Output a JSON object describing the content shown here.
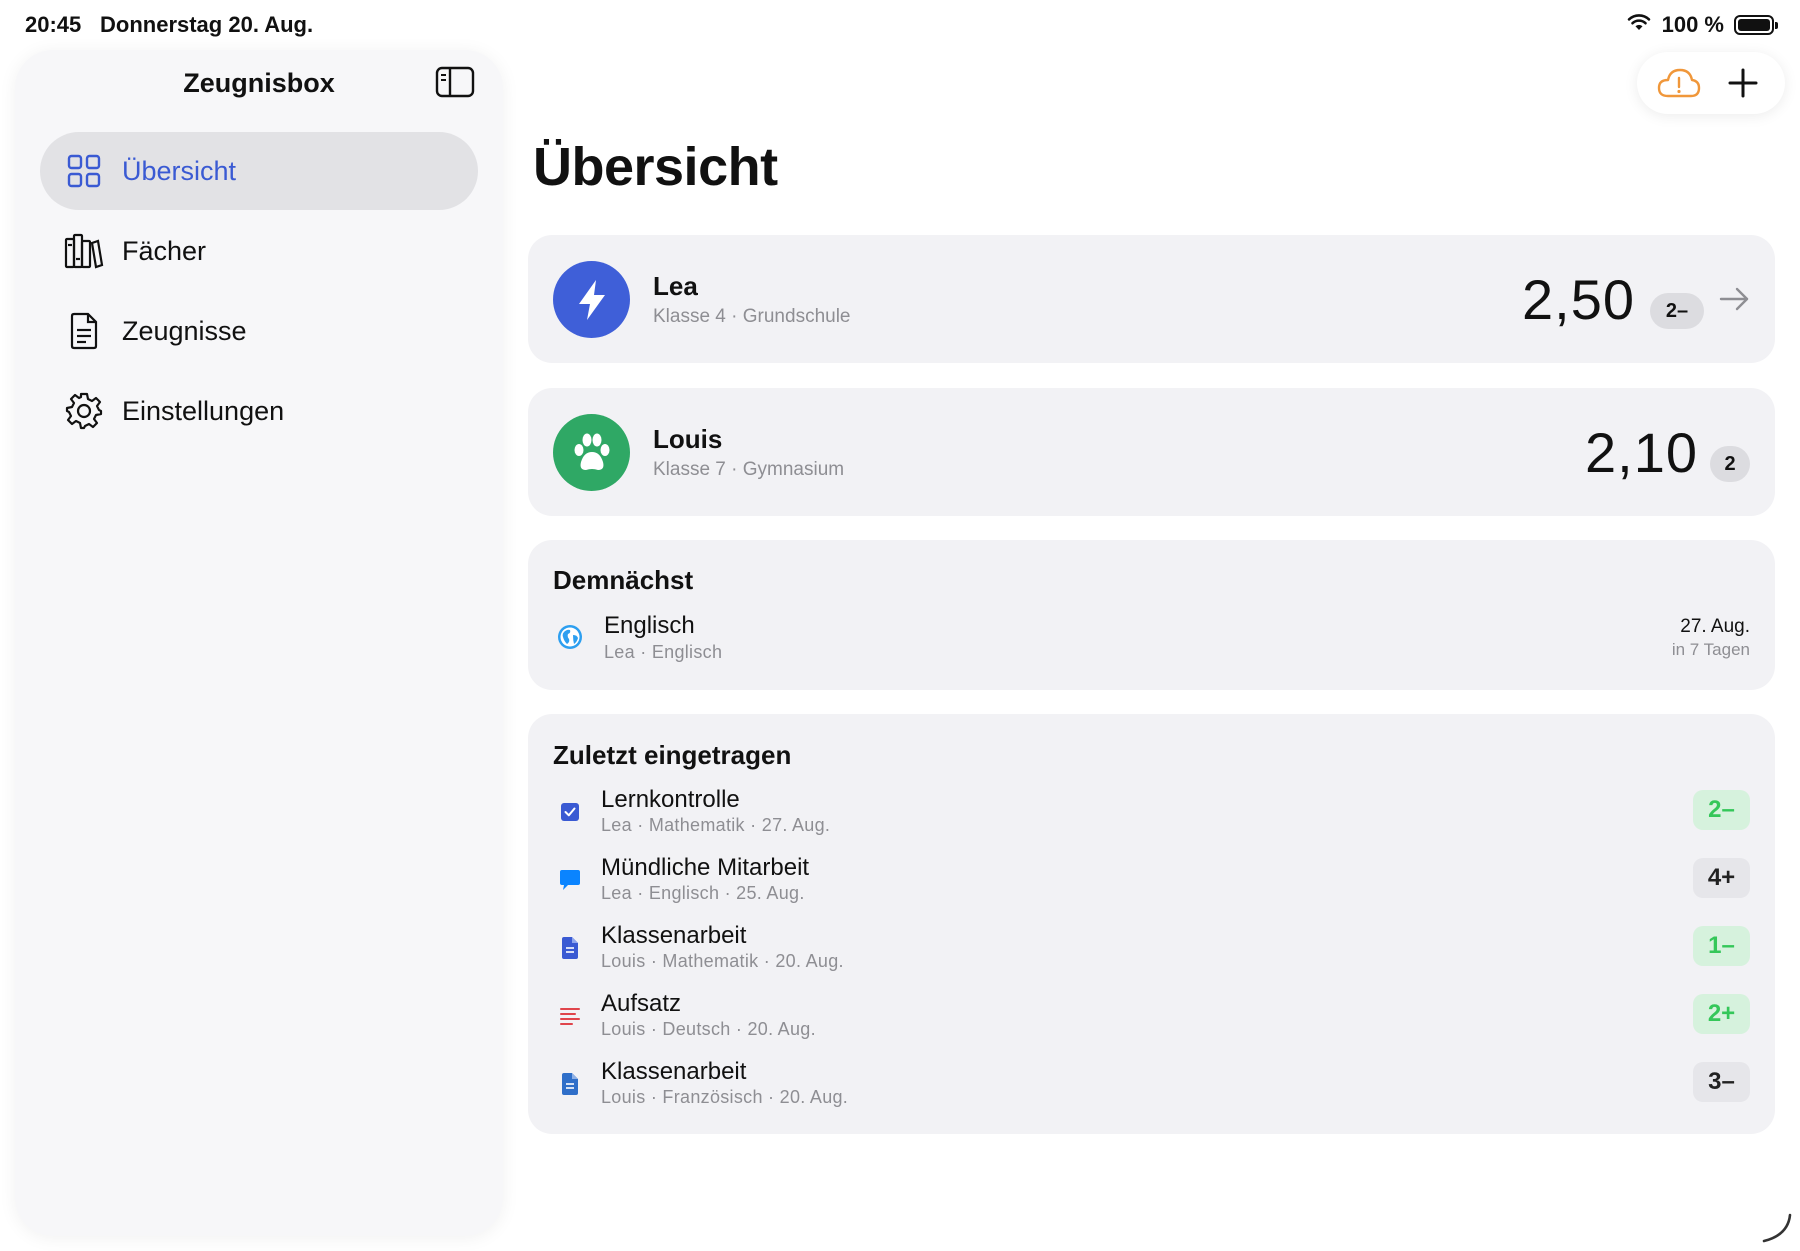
{
  "status": {
    "time": "20:45",
    "date": "Donnerstag 20. Aug.",
    "battery": "100 %"
  },
  "sidebar": {
    "title": "Zeugnisbox",
    "items": [
      {
        "label": "Übersicht",
        "icon": "grid-icon",
        "active": true
      },
      {
        "label": "Fächer",
        "icon": "books-icon",
        "active": false
      },
      {
        "label": "Zeugnisse",
        "icon": "document-icon",
        "active": false
      },
      {
        "label": "Einstellungen",
        "icon": "gear-icon",
        "active": false
      }
    ]
  },
  "main": {
    "title": "Übersicht",
    "students": [
      {
        "name": "Lea",
        "subtitle": "Klasse 4 · Grundschule",
        "average": "2,50",
        "grade": "2–",
        "avatar_color": "#3f5fd8",
        "icon": "bolt-icon"
      },
      {
        "name": "Louis",
        "subtitle": "Klasse 7 · Gymnasium",
        "average": "2,10",
        "grade": "2",
        "avatar_color": "#2fa865",
        "icon": "paw-icon"
      }
    ],
    "upcoming": {
      "title": "Demnächst",
      "items": [
        {
          "title": "Englisch",
          "subtitle": "Lea · Englisch",
          "date": "27. Aug.",
          "relative": "in 7 Tagen",
          "icon": "globe-icon"
        }
      ]
    },
    "recent": {
      "title": "Zuletzt eingetragen",
      "items": [
        {
          "title": "Lernkontrolle",
          "subtitle": "Lea · Mathematik · 27. Aug.",
          "grade": "2–",
          "tone": "good",
          "icon": "checkbox-icon"
        },
        {
          "title": "Mündliche Mitarbeit",
          "subtitle": "Lea · Englisch · 25. Aug.",
          "grade": "4+",
          "tone": "neutral",
          "icon": "speech-bubble-icon"
        },
        {
          "title": "Klassenarbeit",
          "subtitle": "Louis · Mathematik · 20. Aug.",
          "grade": "1–",
          "tone": "good",
          "icon": "document-icon"
        },
        {
          "title": "Aufsatz",
          "subtitle": "Louis · Deutsch · 20. Aug.",
          "grade": "2+",
          "tone": "good",
          "icon": "text-lines-icon"
        },
        {
          "title": "Klassenarbeit",
          "subtitle": "Louis · Französisch · 20. Aug.",
          "grade": "3–",
          "tone": "neutral",
          "icon": "document-icon"
        }
      ]
    }
  },
  "colors": {
    "accent": "#3a5ad3",
    "good": "#34c759",
    "warning": "#f0973a"
  }
}
